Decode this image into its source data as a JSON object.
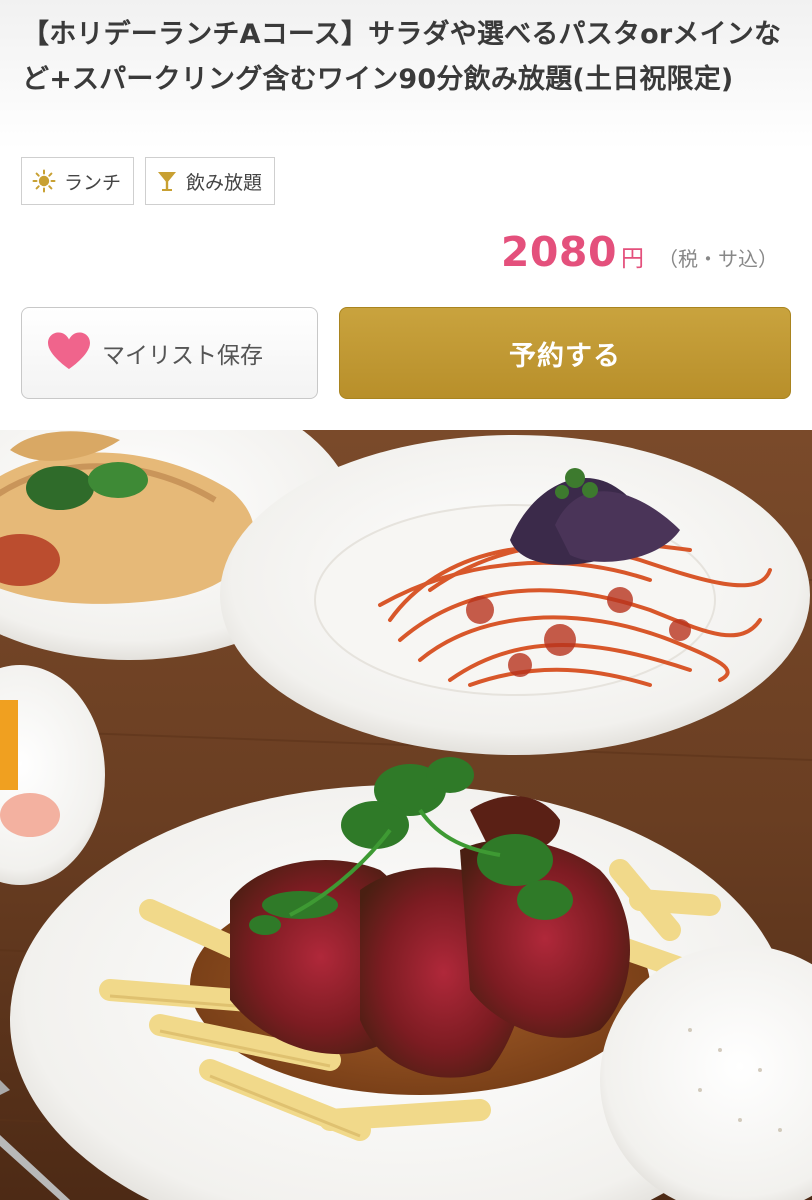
{
  "course": {
    "title": "【ホリデーランチAコース】サラダや選べるパスタorメインなど+スパークリング含むワイン90分飲み放題(土日祝限定)"
  },
  "tags": [
    {
      "label": "ランチ",
      "icon": "sun-icon"
    },
    {
      "label": "飲み放題",
      "icon": "glass-icon"
    }
  ],
  "price": {
    "amount": "2080",
    "unit": "円",
    "tax_note": "（税・サ込）"
  },
  "buttons": {
    "mylist_label": "マイリスト保存",
    "reserve_label": "予約する"
  },
  "colors": {
    "price": "#e4507c",
    "reserve_button": "#c09a34",
    "heart": "#f0648c",
    "tag_icon": "#c8a032"
  },
  "photo": {
    "subject": "food-photo"
  }
}
